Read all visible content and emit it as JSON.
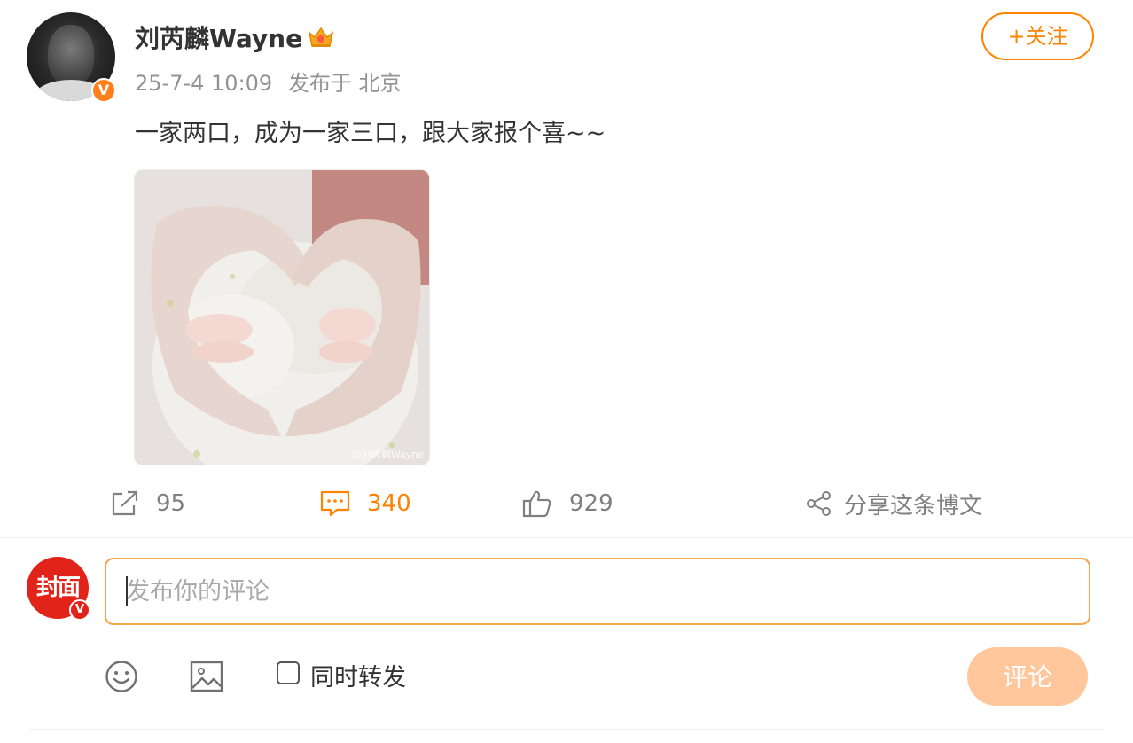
{
  "post": {
    "author": "刘芮麟Wayne",
    "timestamp": "25-7-4 10:09",
    "location": "发布于 北京",
    "follow_label": "+关注",
    "text": "一家两口，成为一家三口，跟大家报个喜~~",
    "verified_badge": "V",
    "image": {
      "watermark": "@刘芮麟Wayne"
    }
  },
  "actions": {
    "repost_count": "95",
    "comment_count": "340",
    "like_count": "929",
    "share_label": "分享这条博文"
  },
  "comment_box": {
    "avatar_text": "封面",
    "avatar_badge": "V",
    "placeholder": "发布你的评论",
    "repost_label": "同时转发",
    "submit_label": "评论"
  },
  "colors": {
    "accent": "#ff8200",
    "muted": "#939393",
    "submit_disabled": "#ffc79b",
    "outlet_red": "#e2231a"
  },
  "icons": [
    "repost-icon",
    "comment-icon",
    "like-icon",
    "share-icon",
    "emoji-icon",
    "image-icon",
    "crown-icon"
  ]
}
